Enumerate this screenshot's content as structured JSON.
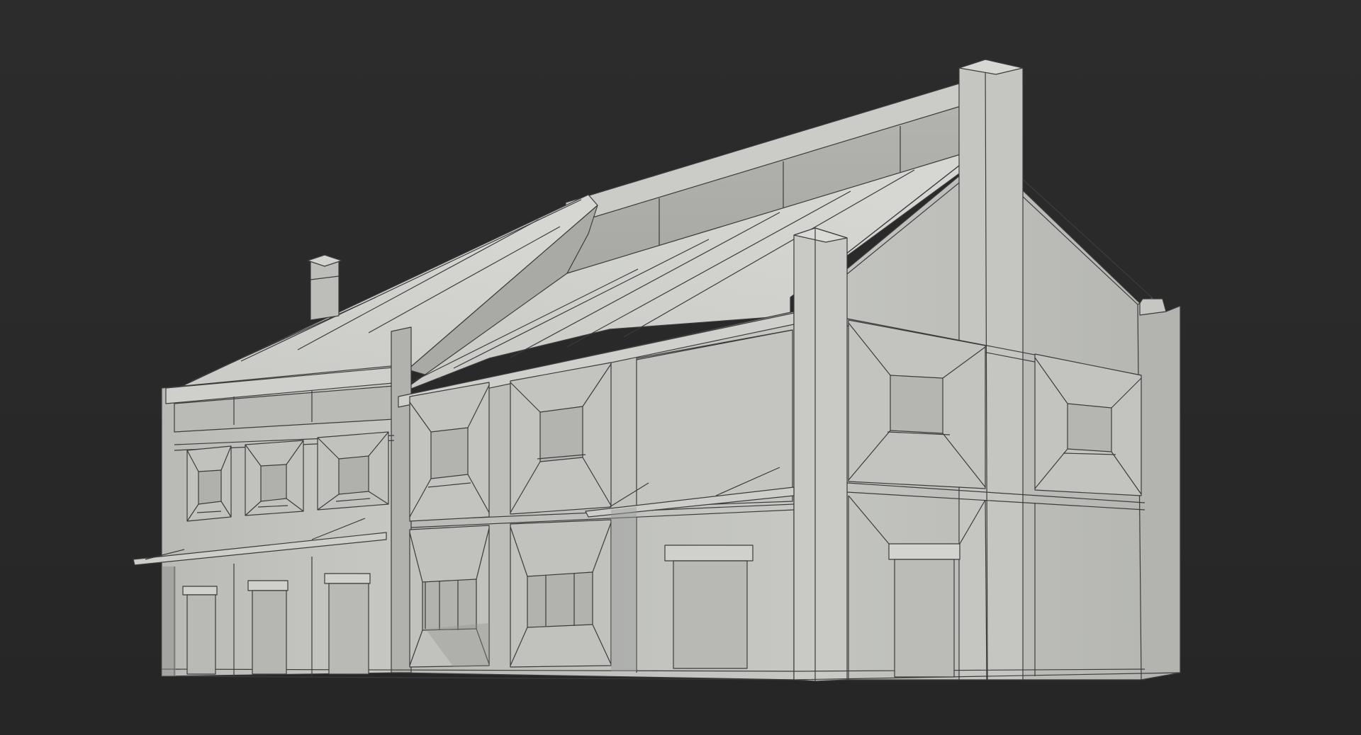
{
  "scene": {
    "subject": "",
    "colors": {
      "background": "#2a2a2a",
      "wall_light": "#c3c4c0",
      "wall_mid": "#b5b6b2",
      "wall_shadow": "#8d8e8b",
      "roof_light": "#d2d3cf",
      "roof_mid": "#bdbeba",
      "wire": "#3b3b3b"
    }
  }
}
